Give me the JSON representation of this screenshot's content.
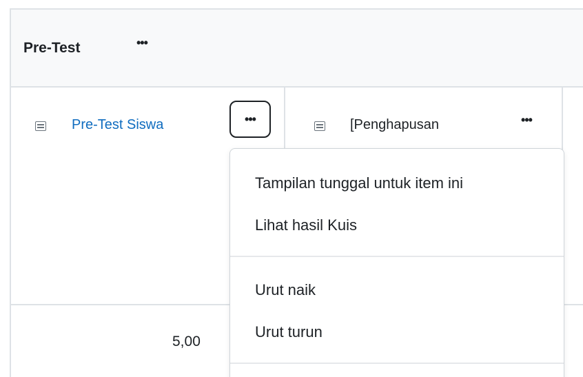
{
  "category": {
    "title": "Pre-Test",
    "actions_label": "•••"
  },
  "items": [
    {
      "name": "Pre-Test Siswa",
      "is_link": true,
      "actions_label": "•••",
      "icon": "quiz-icon"
    },
    {
      "name": "[Penghapusan",
      "is_link": false,
      "actions_label": "•••",
      "icon": "quiz-icon"
    }
  ],
  "grades": {
    "item_1_value": "5,00"
  },
  "dropdown_menu": {
    "items": [
      {
        "label": "Tampilan tunggal untuk item ini"
      },
      {
        "label": "Lihat hasil Kuis"
      },
      {
        "label": "Urut naik"
      },
      {
        "label": "Urut turun"
      }
    ]
  },
  "colors": {
    "link": "#0f6cbf",
    "text": "#1d2125",
    "border": "#dee2e6",
    "header_bg": "#f8f9fa"
  }
}
